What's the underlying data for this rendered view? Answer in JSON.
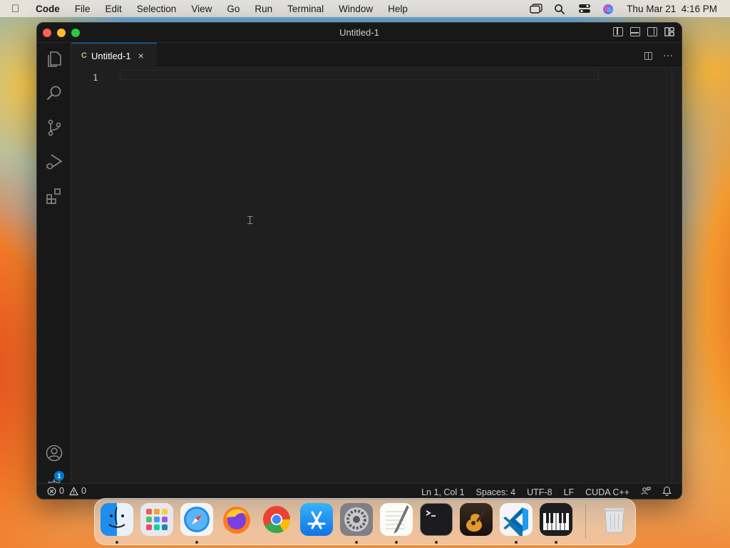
{
  "menubar": {
    "app": "Code",
    "items": [
      "File",
      "Edit",
      "Selection",
      "View",
      "Go",
      "Run",
      "Terminal",
      "Window",
      "Help"
    ],
    "datetime": "Thu Mar 21  4:16 PM",
    "icons": [
      "apple-icon",
      "window-icon",
      "spotlight-icon",
      "control-center-icon",
      "siri-icon"
    ]
  },
  "window": {
    "title": "Untitled-1"
  },
  "activity_bar": {
    "items": [
      "explorer-icon",
      "search-icon",
      "source-control-icon",
      "run-debug-icon",
      "extensions-icon"
    ],
    "bottom": [
      "accounts-icon",
      "manage-gear-icon"
    ],
    "settings_badge": "1"
  },
  "tab": {
    "label": "Untitled-1",
    "close": "×"
  },
  "tab_actions": {
    "split": "◫",
    "more": "···"
  },
  "editor": {
    "line_numbers": [
      "1"
    ]
  },
  "status": {
    "errors": "0",
    "warnings": "0",
    "position": "Ln 1, Col 1",
    "spaces": "Spaces: 4",
    "encoding": "UTF-8",
    "eol": "LF",
    "language": "CUDA C++"
  },
  "dock": {
    "apps": [
      "Finder",
      "Launchpad",
      "Safari",
      "Firefox",
      "Chrome",
      "App Store",
      "System Settings",
      "TextEdit",
      "Terminal",
      "GarageBand",
      "Visual Studio Code",
      "Piano",
      "Trash"
    ]
  }
}
